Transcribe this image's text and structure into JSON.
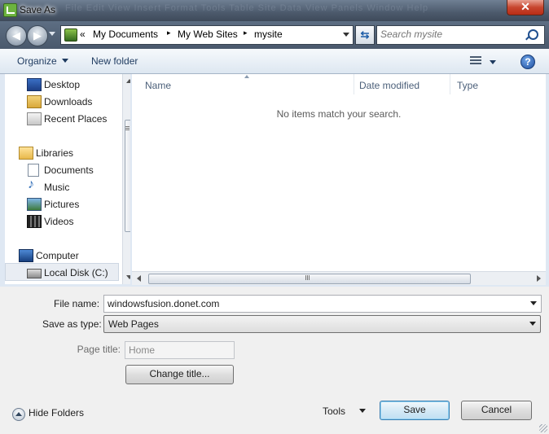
{
  "window": {
    "title": "Save As",
    "close_symbol": "✕",
    "ghost_menu": "File   Edit   View   Insert   Format   Tools   Table   Site   Data View   Panels   Window   Help"
  },
  "nav": {
    "back_symbol": "◀",
    "forward_symbol": "▶",
    "refresh_symbol": "⇆"
  },
  "address": {
    "overflow": "«",
    "crumbs": [
      "My Documents",
      "My Web Sites",
      "mysite"
    ],
    "separator": "▸"
  },
  "search": {
    "placeholder": "Search mysite"
  },
  "toolbar": {
    "organize": "Organize",
    "new_folder": "New folder",
    "help": "?"
  },
  "sidebar": {
    "items": [
      {
        "label": "Desktop",
        "icon": "desktop-icon"
      },
      {
        "label": "Downloads",
        "icon": "downloads-icon"
      },
      {
        "label": "Recent Places",
        "icon": "recent-places-icon"
      },
      {
        "label": "Libraries",
        "icon": "libraries-icon"
      },
      {
        "label": "Documents",
        "icon": "documents-icon"
      },
      {
        "label": "Music",
        "icon": "music-icon"
      },
      {
        "label": "Pictures",
        "icon": "pictures-icon"
      },
      {
        "label": "Videos",
        "icon": "videos-icon"
      },
      {
        "label": "Computer",
        "icon": "computer-icon"
      },
      {
        "label": "Local Disk (C:)",
        "icon": "local-disk-icon"
      }
    ]
  },
  "filelist": {
    "columns": [
      "Name",
      "Date modified",
      "Type"
    ],
    "empty_message": "No items match your search."
  },
  "form": {
    "file_name_label": "File name:",
    "file_name_value": "windowsfusion.donet.com",
    "save_as_type_label": "Save as type:",
    "save_as_type_value": "Web Pages",
    "page_title_label": "Page title:",
    "page_title_value": "Home",
    "change_title_button": "Change title..."
  },
  "footer": {
    "hide_folders": "Hide Folders",
    "tools": "Tools",
    "save": "Save",
    "cancel": "Cancel"
  }
}
